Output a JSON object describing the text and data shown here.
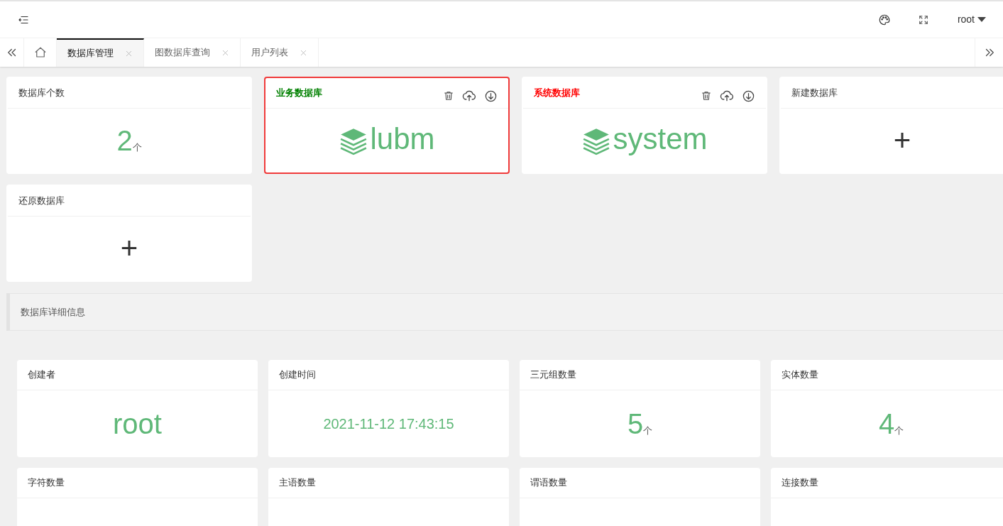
{
  "header": {
    "user": "root"
  },
  "tabs": [
    {
      "label": "数据库管理",
      "selected": true
    },
    {
      "label": "图数据库查询",
      "selected": false
    },
    {
      "label": "用户列表",
      "selected": false
    }
  ],
  "cards": [
    {
      "kind": "count",
      "title": "数据库个数",
      "value": "2",
      "unit": "个"
    },
    {
      "kind": "database",
      "title": "业务数据库",
      "color": "#008000",
      "name": "lubm",
      "selected": true
    },
    {
      "kind": "database",
      "title": "系统数据库",
      "color": "#ff0000",
      "name": "system",
      "selected": false
    },
    {
      "kind": "add",
      "title": "新建数据库",
      "symbol": "+"
    },
    {
      "kind": "add",
      "title": "还原数据库",
      "symbol": "+"
    }
  ],
  "detail": {
    "title": "数据库详细信息",
    "stats": [
      {
        "title": "创建者",
        "value": "root",
        "kind": "text"
      },
      {
        "title": "创建时间",
        "value": "2021-11-12 17:43:15",
        "kind": "time"
      },
      {
        "title": "三元组数量",
        "value": "5",
        "unit": "个",
        "kind": "number"
      },
      {
        "title": "实体数量",
        "value": "4",
        "unit": "个",
        "kind": "number"
      },
      {
        "title": "字符数量"
      },
      {
        "title": "主语数量"
      },
      {
        "title": "谓语数量"
      },
      {
        "title": "连接数量"
      }
    ]
  }
}
